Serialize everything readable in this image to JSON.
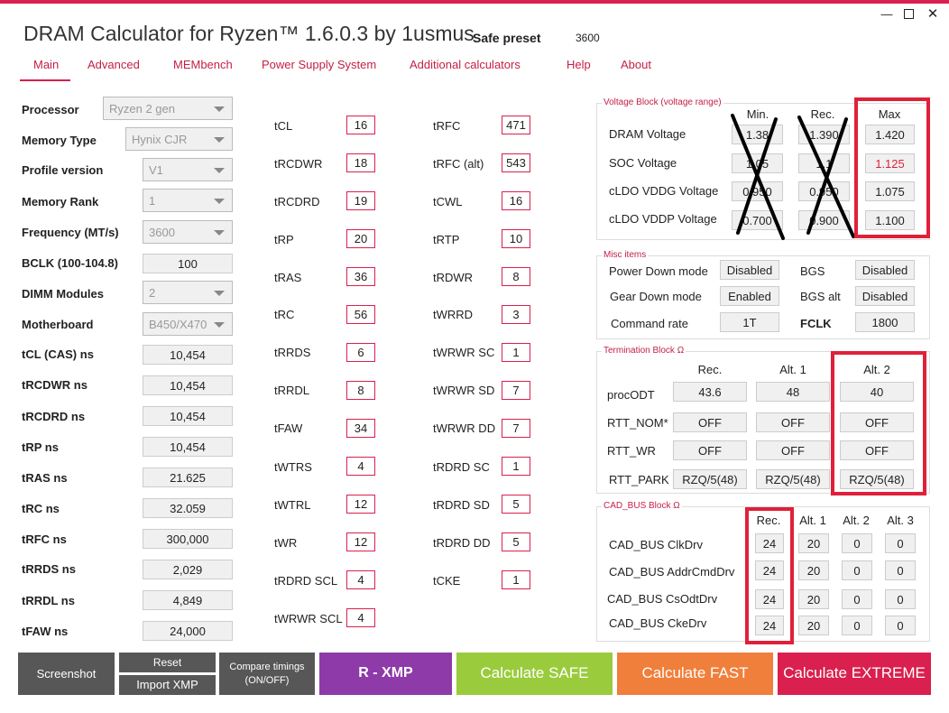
{
  "app": {
    "title": "DRAM Calculator for Ryzen™ 1.6.0.3 by 1usmus",
    "preset_label": "Safe preset",
    "preset_value": "3600",
    "window_controls": [
      "minimize-icon",
      "maximize-icon",
      "close-icon"
    ]
  },
  "nav": [
    "Main",
    "Advanced",
    "MEMbench",
    "Power Supply System",
    "Additional calculators",
    "Help",
    "About"
  ],
  "settings": {
    "processor": {
      "label": "Processor",
      "value": "Ryzen 2 gen"
    },
    "memory_type": {
      "label": "Memory Type",
      "value": "Hynix CJR"
    },
    "profile_version": {
      "label": "Profile version",
      "value": "V1"
    },
    "memory_rank": {
      "label": "Memory Rank",
      "value": "1"
    },
    "frequency": {
      "label": "Frequency (MT/s)",
      "value": "3600"
    },
    "bclk": {
      "label": "BCLK (100-104.8)",
      "value": "100"
    },
    "dimm_modules": {
      "label": "DIMM Modules",
      "value": "2"
    },
    "motherboard": {
      "label": "Motherboard",
      "value": "B450/X470"
    }
  },
  "ns_values": [
    {
      "label": "tCL (CAS) ns",
      "value": "10,454"
    },
    {
      "label": "tRCDWR ns",
      "value": "10,454"
    },
    {
      "label": "tRCDRD ns",
      "value": "10,454"
    },
    {
      "label": "tRP ns",
      "value": "10,454"
    },
    {
      "label": "tRAS ns",
      "value": "21.625"
    },
    {
      "label": "tRC ns",
      "value": "32.059"
    },
    {
      "label": "tRFC ns",
      "value": "300,000"
    },
    {
      "label": "tRRDS ns",
      "value": "2,029"
    },
    {
      "label": "tRRDL ns",
      "value": "4,849"
    },
    {
      "label": "tFAW ns",
      "value": "24,000"
    }
  ],
  "timings_col1": [
    {
      "label": "tCL",
      "value": "16"
    },
    {
      "label": "tRCDWR",
      "value": "18"
    },
    {
      "label": "tRCDRD",
      "value": "19"
    },
    {
      "label": "tRP",
      "value": "20"
    },
    {
      "label": "tRAS",
      "value": "36"
    },
    {
      "label": "tRC",
      "value": "56"
    },
    {
      "label": "tRRDS",
      "value": "6"
    },
    {
      "label": "tRRDL",
      "value": "8"
    },
    {
      "label": "tFAW",
      "value": "34"
    },
    {
      "label": "tWTRS",
      "value": "4"
    },
    {
      "label": "tWTRL",
      "value": "12"
    },
    {
      "label": "tWR",
      "value": "12"
    },
    {
      "label": "tRDRD SCL",
      "value": "4"
    },
    {
      "label": "tWRWR SCL",
      "value": "4"
    }
  ],
  "timings_col2": [
    {
      "label": "tRFC",
      "value": "471"
    },
    {
      "label": "tRFC (alt)",
      "value": "543"
    },
    {
      "label": "tCWL",
      "value": "16"
    },
    {
      "label": "tRTP",
      "value": "10"
    },
    {
      "label": "tRDWR",
      "value": "8"
    },
    {
      "label": "tWRRD",
      "value": "3"
    },
    {
      "label": "tWRWR SC",
      "value": "1"
    },
    {
      "label": "tWRWR SD",
      "value": "7"
    },
    {
      "label": "tWRWR DD",
      "value": "7"
    },
    {
      "label": "tRDRD SC",
      "value": "1"
    },
    {
      "label": "tRDRD SD",
      "value": "5"
    },
    {
      "label": "tRDRD DD",
      "value": "5"
    },
    {
      "label": "tCKE",
      "value": "1"
    }
  ],
  "voltage_block": {
    "title": "Voltage Block (voltage range)",
    "headers": [
      "Min.",
      "Rec.",
      "Max"
    ],
    "rows": [
      {
        "label": "DRAM Voltage",
        "min": "1.38",
        "rec": "1.390",
        "max": "1.420"
      },
      {
        "label": "SOC Voltage",
        "min": "1.05",
        "rec": "1.1",
        "max": "1.125"
      },
      {
        "label": "cLDO VDDG Voltage",
        "min": "0.950",
        "rec": "0.950",
        "max": "1.075"
      },
      {
        "label": "cLDO VDDP Voltage",
        "min": "0.700",
        "rec": "0.900",
        "max": "1.100"
      }
    ],
    "max_highlight_color": "#e0203a"
  },
  "misc": {
    "title": "Misc items",
    "power_down": {
      "label": "Power Down mode",
      "value": "Disabled"
    },
    "gear_down": {
      "label": "Gear Down mode",
      "value": "Enabled"
    },
    "command_rate": {
      "label": "Command rate",
      "value": "1T"
    },
    "bgs": {
      "label": "BGS",
      "value": "Disabled"
    },
    "bgs_alt": {
      "label": "BGS alt",
      "value": "Disabled"
    },
    "fclk": {
      "label": "FCLK",
      "value": "1800"
    }
  },
  "termination": {
    "title": "Termination Block Ω",
    "headers": [
      "Rec.",
      "Alt. 1",
      "Alt. 2"
    ],
    "rows": [
      {
        "label": "procODT",
        "values": [
          "43.6",
          "48",
          "40"
        ]
      },
      {
        "label": "RTT_NOM*",
        "values": [
          "OFF",
          "OFF",
          "OFF"
        ]
      },
      {
        "label": "RTT_WR",
        "values": [
          "OFF",
          "OFF",
          "OFF"
        ]
      },
      {
        "label": "RTT_PARK",
        "values": [
          "RZQ/5(48)",
          "RZQ/5(48)",
          "RZQ/5(48)"
        ]
      }
    ]
  },
  "cad_bus": {
    "title": "CAD_BUS Block Ω",
    "headers": [
      "Rec.",
      "Alt. 1",
      "Alt. 2",
      "Alt. 3"
    ],
    "rows": [
      {
        "label": "CAD_BUS ClkDrv",
        "values": [
          "24",
          "20",
          "0",
          "0"
        ]
      },
      {
        "label": "CAD_BUS AddrCmdDrv",
        "values": [
          "24",
          "20",
          "0",
          "0"
        ]
      },
      {
        "label": "CAD_BUS CsOdtDrv",
        "values": [
          "24",
          "20",
          "0",
          "0"
        ]
      },
      {
        "label": "CAD_BUS CkeDrv",
        "values": [
          "24",
          "20",
          "0",
          "0"
        ]
      }
    ]
  },
  "buttons": {
    "screenshot": "Screenshot",
    "reset": "Reset",
    "import_xmp": "Import XMP",
    "compare_line1": "Compare timings",
    "compare_line2": "(ON/OFF)",
    "r_xmp": "R - XMP",
    "calc_safe": "Calculate SAFE",
    "calc_fast": "Calculate FAST",
    "calc_extreme": "Calculate EXTREME"
  },
  "colors": {
    "accent": "#d9204f",
    "gray_button": "#575757",
    "r_xmp": "#8e3aa8",
    "safe": "#9acb3c",
    "fast": "#f07f3c",
    "extreme": "#d9204f"
  }
}
